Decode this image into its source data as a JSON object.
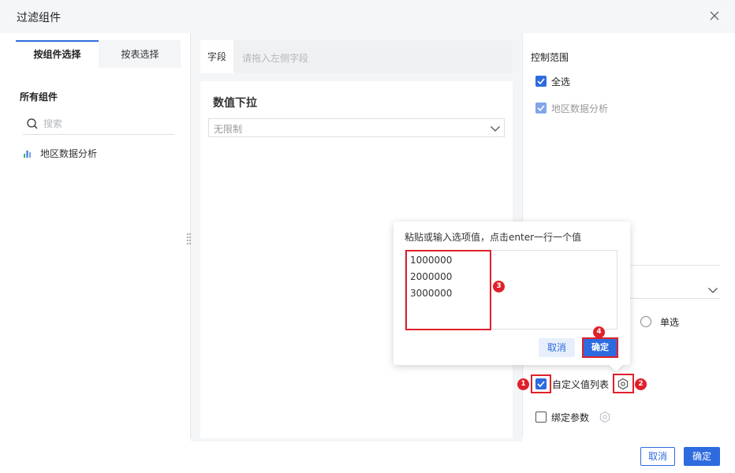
{
  "dialog": {
    "title": "过滤组件"
  },
  "left": {
    "tabs": [
      {
        "label": "按组件选择"
      },
      {
        "label": "按表选择"
      }
    ],
    "section_title": "所有组件",
    "search_placeholder": "搜索",
    "components": [
      {
        "label": "地区数据分析"
      }
    ]
  },
  "middle": {
    "field_label": "字段",
    "field_placeholder": "请拖入左侧字段",
    "widget_title": "数值下拉",
    "limit_value": "无限制"
  },
  "right": {
    "control_title": "控制范围",
    "select_all": "全选",
    "component_item": "地区数据分析",
    "single_select": "单选",
    "custom_list": "自定义值列表",
    "bind_param": "绑定参数"
  },
  "popover": {
    "hint": "粘贴或输入选项值，点击enter一行一个值",
    "values": [
      "1000000",
      "2000000",
      "3000000"
    ],
    "cancel": "取消",
    "confirm": "确定"
  },
  "annotations": [
    "1",
    "2",
    "3",
    "4"
  ],
  "footer": {
    "cancel": "取消",
    "confirm": "确定"
  },
  "colors": {
    "primary": "#2e6bdf",
    "annotation": "#e0202a"
  }
}
